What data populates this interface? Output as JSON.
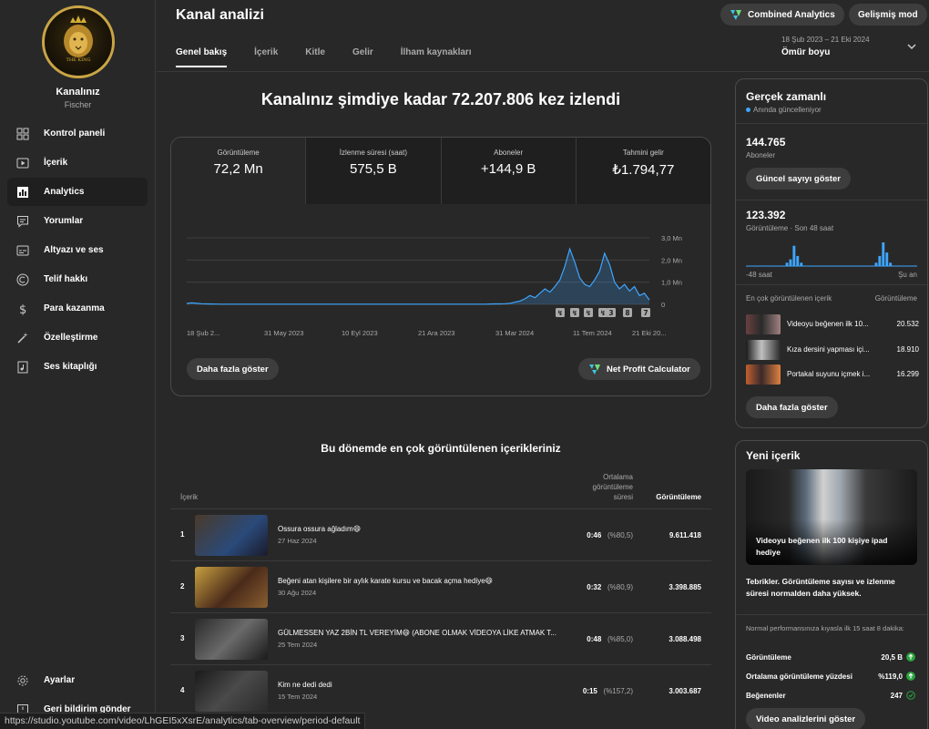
{
  "sidebar": {
    "channel_name": "Kanalınız",
    "channel_sub": "Fischer",
    "logo_text": "THE KING",
    "items": [
      {
        "label": "Kontrol paneli",
        "icon": "dashboard-icon"
      },
      {
        "label": "İçerik",
        "icon": "content-icon"
      },
      {
        "label": "Analytics",
        "icon": "analytics-icon"
      },
      {
        "label": "Yorumlar",
        "icon": "comments-icon"
      },
      {
        "label": "Altyazı ve ses",
        "icon": "subtitles-icon"
      },
      {
        "label": "Telif hakkı",
        "icon": "copyright-icon"
      },
      {
        "label": "Para kazanma",
        "icon": "dollar-icon"
      },
      {
        "label": "Özelleştirme",
        "icon": "magic-wand-icon"
      },
      {
        "label": "Ses kitaplığı",
        "icon": "audio-library-icon"
      }
    ],
    "settings_label": "Ayarlar",
    "feedback_label": "Geri bildirim gönder"
  },
  "header": {
    "title": "Kanal analizi",
    "combined_label": "Combined Analytics",
    "advanced_label": "Gelişmiş mod",
    "tabs": [
      "Genel bakış",
      "İçerik",
      "Kitle",
      "Gelir",
      "İlham kaynakları"
    ],
    "date_range": "18 Şub 2023 – 21 Eki 2024",
    "date_label": "Ömür boyu"
  },
  "overview": {
    "headline": "Kanalınız şimdiye kadar 72.207.806 kez izlendi",
    "metrics": [
      {
        "label": "Görüntüleme",
        "value": "72,2 Mn"
      },
      {
        "label": "İzlenme süresi (saat)",
        "value": "575,5 B"
      },
      {
        "label": "Aboneler",
        "value": "+144,9 B"
      },
      {
        "label": "Tahmini gelir",
        "value": "₺1.794,77"
      }
    ],
    "more_label": "Daha fazla göster",
    "calc_label": "Net Profit Calculator"
  },
  "chart_data": {
    "type": "area",
    "title": "",
    "x_tick_labels": [
      "18 Şub 2...",
      "31 May 2023",
      "10 Eyl 2023",
      "21 Ara 2023",
      "31 Mar 2024",
      "11 Tem 2024",
      "21 Eki 20..."
    ],
    "y_tick_labels": [
      "3,0 Mn",
      "2,0 Mn",
      "1,0 Mn",
      "0"
    ],
    "ylim": [
      0,
      3000000
    ],
    "series": [
      {
        "values": [
          40000,
          70000,
          50000,
          30000,
          20000,
          15000,
          12000,
          10000,
          10000,
          10000,
          10000,
          10000,
          10000,
          10000,
          10000,
          10000,
          10000,
          10000,
          10000,
          10000,
          10000,
          10000,
          10000,
          10000,
          10000,
          10000,
          10000,
          10000,
          10000,
          10000,
          10000,
          10000,
          10000,
          10000,
          10000,
          10000,
          10000,
          10000,
          10000,
          10000,
          10000,
          10000,
          10000,
          10000,
          10000,
          10000,
          10000,
          10000,
          10000,
          10000,
          10000,
          10000,
          10000,
          10000,
          10000,
          10000,
          10000,
          10000,
          10000,
          10000,
          10000,
          15000,
          20000,
          20000,
          30000,
          50000,
          100000,
          150000,
          250000,
          400000,
          300000,
          500000,
          700000,
          550000,
          800000,
          1100000,
          1700000,
          2500000,
          1900000,
          1200000,
          900000,
          800000,
          1100000,
          1500000,
          2300000,
          1800000,
          1000000,
          700000,
          900000,
          600000,
          800000,
          400000,
          500000,
          200000
        ]
      }
    ],
    "markers": [
      "↯",
      "↯",
      "↯",
      "↯",
      "3",
      "8",
      "7"
    ],
    "grid": true
  },
  "top_content": {
    "title": "Bu dönemde en çok görüntülenen içerikleriniz",
    "col_content": "İçerik",
    "col_avg": "Ortalama görüntüleme süresi",
    "col_views": "Görüntüleme",
    "rows": [
      {
        "n": "1",
        "title": "Ossura ossura ağladım😄",
        "date": "27 Haz 2024",
        "avg": "0:46",
        "pct": "(%80,5)",
        "views": "9.611.418"
      },
      {
        "n": "2",
        "title": "Beğeni atan kişilere bir aylık karate kursu ve bacak açma hediye😄",
        "date": "30 Ağu 2024",
        "avg": "0:32",
        "pct": "(%80,9)",
        "views": "3.398.885"
      },
      {
        "n": "3",
        "title": "GÜLMESSEN YAZ 2BİN TL VEREYİM😄 (ABONE OLMAK VİDEOYA LİKE ATMAK T...",
        "date": "25 Tem 2024",
        "avg": "0:48",
        "pct": "(%85,0)",
        "views": "3.088.498"
      },
      {
        "n": "4",
        "title": "Kim ne dedi dedi",
        "date": "15 Tem 2024",
        "avg": "0:15",
        "pct": "(%157,2)",
        "views": "3.003.687"
      }
    ]
  },
  "realtime": {
    "title": "Gerçek zamanlı",
    "live": "Anında güncelleniyor",
    "subs_value": "144.765",
    "subs_label": "Aboneler",
    "subs_btn": "Güncel sayıyı göster",
    "views_value": "123.392",
    "views_label": "Görüntüleme · Son 48 saat",
    "axis_left": "-48 saat",
    "axis_right": "Şu an",
    "bars": [
      0,
      0,
      0,
      0,
      0,
      0,
      0,
      0,
      0,
      0,
      0,
      1,
      2,
      6,
      3,
      1,
      0,
      0,
      0,
      0,
      0,
      0,
      0,
      0,
      0,
      0,
      0,
      0,
      0,
      0,
      0,
      0,
      0,
      0,
      0,
      0,
      1,
      3,
      7,
      4,
      1,
      0,
      0,
      0,
      0,
      0,
      0,
      0
    ],
    "top_label": "En çok görüntülenen içerik",
    "top_views_label": "Görüntüleme",
    "top_items": [
      {
        "title": "Videoyu beğenen ilk 10...",
        "views": "20.532"
      },
      {
        "title": "Kıza dersini yapması içi...",
        "views": "18.910"
      },
      {
        "title": "Portakal suyunu içmek i...",
        "views": "16.299"
      }
    ],
    "more_btn": "Daha fazla göster"
  },
  "new_content": {
    "title": "Yeni içerik",
    "video_title": "Videoyu beğenen ilk 100 kişiye ipad hediye",
    "congrats": "Tebrikler. Görüntüleme sayısı ve izlenme süresi normalden daha yüksek.",
    "compare_text": "Normal performansınıza kıyasla ilk 15 saat 8 dakika:",
    "stats": [
      {
        "label": "Görüntüleme",
        "value": "20,5 B",
        "icon": "arrow-up-icon",
        "color": "#2ba640"
      },
      {
        "label": "Ortalama görüntüleme yüzdesi",
        "value": "%119,0",
        "icon": "arrow-up-icon",
        "color": "#2ba640"
      },
      {
        "label": "Beğenenler",
        "value": "247",
        "icon": "check-circle-icon",
        "color": "#2ba640"
      }
    ],
    "btn": "Video analizlerini göster"
  },
  "status_url": "https://studio.youtube.com/video/LhGEI5xXsrE/analytics/tab-overview/period-default"
}
